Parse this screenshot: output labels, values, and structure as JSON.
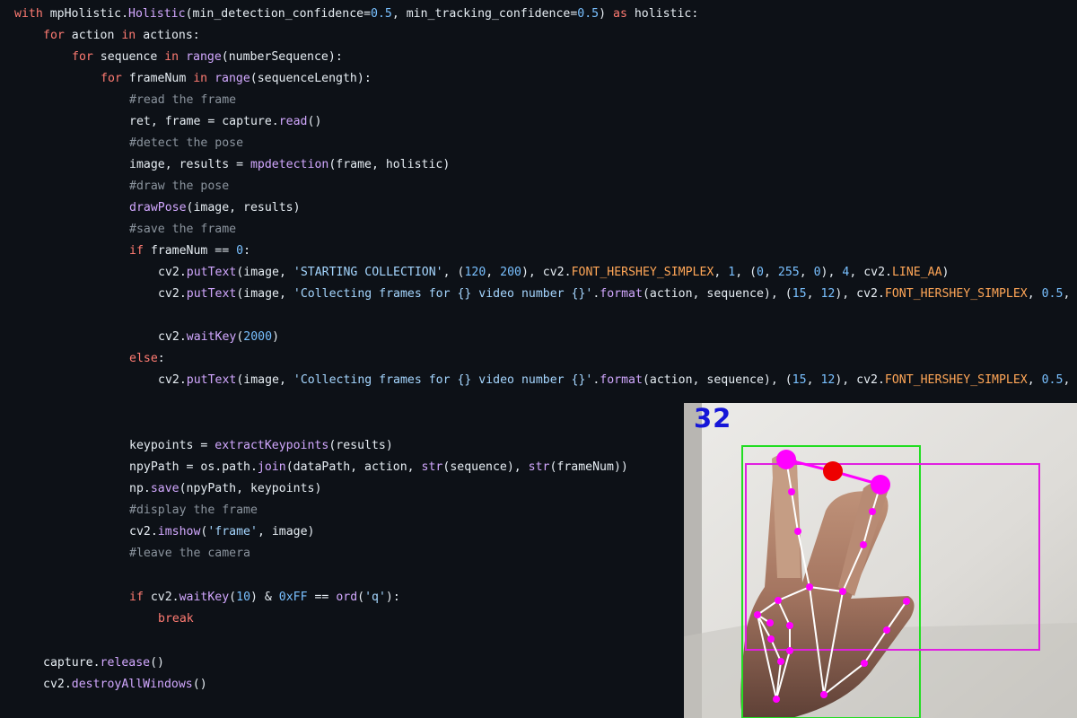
{
  "code": {
    "l1": {
      "k1": "with",
      "t1": " mpHolistic.",
      "f1": "Holistic",
      "t2": "(min_detection_confidence=",
      "n1": "0.5",
      "t3": ", min_tracking_confidence=",
      "n2": "0.5",
      "t4": ") ",
      "k2": "as",
      "t5": " holistic:"
    },
    "l2": {
      "k1": "for",
      "t1": " action ",
      "k2": "in",
      "t2": " actions:"
    },
    "l3": {
      "k1": "for",
      "t1": " sequence ",
      "k2": "in",
      "t2": " ",
      "f1": "range",
      "t3": "(numberSequence):"
    },
    "l4": {
      "k1": "for",
      "t1": " frameNum ",
      "k2": "in",
      "t2": " ",
      "f1": "range",
      "t3": "(sequenceLength):"
    },
    "l5": {
      "c": "#read the frame"
    },
    "l6": {
      "t1": "ret, frame = capture.",
      "f1": "read",
      "t2": "()"
    },
    "l7": {
      "c": "#detect the pose"
    },
    "l8": {
      "t1": "image, results = ",
      "f1": "mpdetection",
      "t2": "(frame, holistic)"
    },
    "l9": {
      "c": "#draw the pose"
    },
    "l10": {
      "f1": "drawPose",
      "t1": "(image, results)"
    },
    "l11": {
      "c": "#save the frame"
    },
    "l12": {
      "k1": "if",
      "t1": " frameNum == ",
      "n1": "0",
      "t2": ":"
    },
    "l13": {
      "t1": "cv2.",
      "f1": "putText",
      "t2": "(image, ",
      "s1": "'STARTING COLLECTION'",
      "t3": ", (",
      "n1": "120",
      "t4": ", ",
      "n2": "200",
      "t5": "), cv2.",
      "c1": "FONT_HERSHEY_SIMPLEX",
      "t6": ", ",
      "n3": "1",
      "t7": ", (",
      "n4": "0",
      "t8": ", ",
      "n5": "255",
      "t9": ", ",
      "n6": "0",
      "t10": "), ",
      "n7": "4",
      "t11": ", cv2.",
      "c2": "LINE_AA",
      "t12": ")"
    },
    "l14": {
      "t1": "cv2.",
      "f1": "putText",
      "t2": "(image, ",
      "s1": "'Collecting frames for {} video number {}'",
      "t3": ".",
      "f2": "format",
      "t4": "(action, sequence), (",
      "n1": "15",
      "t5": ", ",
      "n2": "12",
      "t6": "), cv2.",
      "c1": "FONT_HERSHEY_SIMPLEX",
      "t7": ", ",
      "n3": "0.5",
      "t8": ","
    },
    "l15": {
      "t1": "cv2.",
      "f1": "waitKey",
      "t2": "(",
      "n1": "2000",
      "t3": ")"
    },
    "l16": {
      "k1": "else",
      "t1": ":"
    },
    "l17": {
      "t1": "cv2.",
      "f1": "putText",
      "t2": "(image, ",
      "s1": "'Collecting frames for {} video number {}'",
      "t3": ".",
      "f2": "format",
      "t4": "(action, sequence), (",
      "n1": "15",
      "t5": ", ",
      "n2": "12",
      "t6": "), cv2.",
      "c1": "FONT_HERSHEY_SIMPLEX",
      "t7": ", ",
      "n3": "0.5",
      "t8": ","
    },
    "l18": {
      "t1": "keypoints = ",
      "f1": "extractKeypoints",
      "t2": "(results)"
    },
    "l19": {
      "t1": "npyPath = os.path.",
      "f1": "join",
      "t2": "(dataPath, action, ",
      "f2": "str",
      "t3": "(sequence), ",
      "f3": "str",
      "t4": "(frameNum))"
    },
    "l20": {
      "t1": "np.",
      "f1": "save",
      "t2": "(npyPath, keypoints)"
    },
    "l21": {
      "c": "#display the frame"
    },
    "l22": {
      "t1": "cv2.",
      "f1": "imshow",
      "t2": "(",
      "s1": "'frame'",
      "t3": ", image)"
    },
    "l23": {
      "c": "#leave the camera"
    },
    "l24": {
      "k1": "if",
      "t1": " cv2.",
      "f1": "waitKey",
      "t2": "(",
      "n1": "10",
      "t3": ") & ",
      "n2": "0xFF",
      "t4": " == ",
      "f2": "ord",
      "t5": "(",
      "s1": "'q'",
      "t6": "):"
    },
    "l25": {
      "k1": "break"
    },
    "l26": {
      "t1": "capture.",
      "f1": "release",
      "t2": "()"
    },
    "l27": {
      "t1": "cv2.",
      "f1": "destroyAllWindows",
      "t2": "()"
    }
  },
  "camera": {
    "frame_counter": "32"
  },
  "colors": {
    "background": "#0d1117",
    "keyword": "#ff7b72",
    "function": "#d2a8ff",
    "number": "#79c0ff",
    "string": "#a5d6ff",
    "constant": "#ffa657",
    "comment": "#8b949e",
    "text": "#e6edf3",
    "bbox_green": "#22dd22",
    "bbox_magenta": "#e020e0",
    "landmark": "#ff00ff",
    "midpoint": "#ee0000",
    "counter": "#1616d8"
  }
}
